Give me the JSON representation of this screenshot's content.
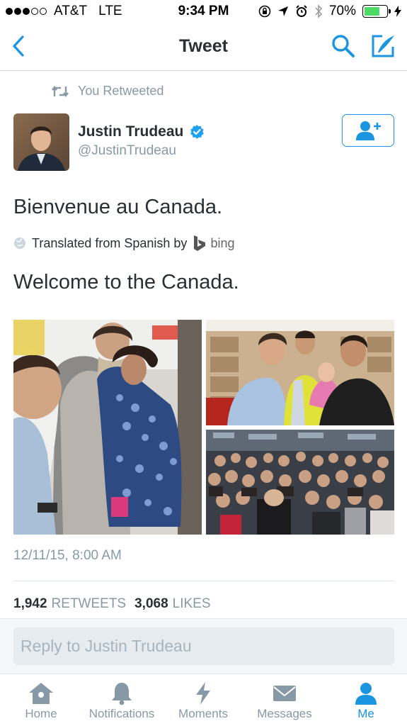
{
  "status_bar": {
    "carrier": "AT&T",
    "network": "LTE",
    "time": "9:34 PM",
    "battery": "70%",
    "battery_level": 0.7,
    "signal_bars": 3,
    "signal_total": 5
  },
  "nav": {
    "title": "Tweet",
    "icons": [
      "chevron-left-icon",
      "search-icon",
      "compose-icon"
    ]
  },
  "retweet_context": {
    "text": "You Retweeted"
  },
  "author": {
    "name": "Justin Trudeau",
    "handle": "@JustinTrudeau",
    "verified": true
  },
  "tweet": {
    "text": "Bienvenue au Canada.",
    "translated_label": "Translated from Spanish by",
    "translator": "bing",
    "translation": "Welcome to the Canada.",
    "timestamp": "12/11/15, 8:00 AM",
    "retweets_count": "1,942",
    "retweets_label": "RETWEETS",
    "likes_count": "3,068",
    "likes_label": "LIKES"
  },
  "reply": {
    "placeholder": "Reply to Justin Trudeau"
  },
  "tabs": [
    {
      "label": "Home",
      "icon": "home-icon"
    },
    {
      "label": "Notifications",
      "icon": "bell-icon"
    },
    {
      "label": "Moments",
      "icon": "lightning-icon"
    },
    {
      "label": "Messages",
      "icon": "envelope-icon"
    },
    {
      "label": "Me",
      "icon": "person-icon",
      "active": true
    }
  ],
  "colors": {
    "accent": "#1b95e0",
    "muted": "#8899a6",
    "text": "#292f33",
    "battery": "#4cd964"
  }
}
